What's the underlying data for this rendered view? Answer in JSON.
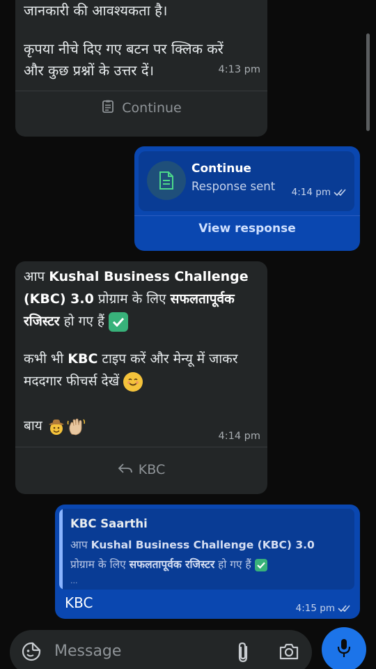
{
  "messages": {
    "m1": {
      "line1": "जानकारी की आवश्यकता है।",
      "line2": "कृपया नीचे दिए गए बटन पर क्लिक करें",
      "line3": "और कुछ प्रश्नों के उत्तर दें।",
      "time": "4:13 pm",
      "button_label": "Continue"
    },
    "m2": {
      "title": "Continue",
      "subtitle": "Response sent",
      "time": "4:14 pm",
      "action_label": "View response"
    },
    "m3": {
      "p1_a": "आप ",
      "p1_b": "Kushal Business Challenge",
      "p1_c": "(KBC) 3.0",
      "p1_d": " प्रोग्राम के लिए ",
      "p1_e": "सफलतापूर्वक",
      "p1_f": "रजिस्टर",
      "p1_g": " हो गए हैं ",
      "p2_a": "कभी भी ",
      "p2_b": "KBC",
      "p2_c": " टाइप करें और मेन्यू में जाकर",
      "p2_d": "मददगार फीचर्स देखें ",
      "p3": "बाय ",
      "time": "4:14 pm",
      "button_label": "KBC"
    },
    "m4": {
      "quote_sender": "KBC Saarthi",
      "quote_a": "आप ",
      "quote_b": "Kushal Business Challenge (KBC) 3.0",
      "quote_c": "प्रोग्राम के लिए ",
      "quote_d": "सफलतापूर्वक रजिस्टर",
      "quote_e": " हो गए हैं ",
      "quote_ellipsis": "...",
      "text": "KBC",
      "time": "4:15 pm"
    }
  },
  "composer": {
    "placeholder": "Message"
  },
  "colors": {
    "incoming_bubble": "#232627",
    "outgoing_bubble": "#0a47b0",
    "mic_button": "#1c74e9",
    "check_green": "#38b27a"
  }
}
